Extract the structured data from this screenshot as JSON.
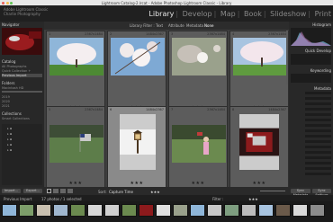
{
  "window": {
    "title": "Lightroom Catalog-2.lrcat - Adobe Photoshop Lightroom Classic - Library"
  },
  "identity": {
    "line1": "Adobe Lightroom Classic",
    "line2": "Charlie Photography"
  },
  "modules": {
    "items": [
      "Library",
      "Develop",
      "Map",
      "Book",
      "Slideshow",
      "Print"
    ],
    "active": "Library"
  },
  "left_panel": {
    "sections": [
      {
        "title": "Navigator",
        "items": []
      },
      {
        "title": "Catalog",
        "items": [
          "All Photographs",
          "Quick Collection +",
          "Previous Import"
        ]
      },
      {
        "title": "Folders",
        "items": [
          "Macintosh HD",
          "2019",
          "2020",
          "2021"
        ]
      },
      {
        "title": "Collections",
        "items": [
          "Smart Collections"
        ]
      }
    ],
    "import_label": "Import...",
    "export_label": "Export..."
  },
  "filter_bar": {
    "label": "Library Filter :",
    "options": [
      "Text",
      "Attribute",
      "Metadata",
      "None"
    ],
    "active": "None"
  },
  "grid": {
    "cells": [
      {
        "index": "1",
        "dims": "2367x1484",
        "rating": "★★★",
        "thumb": "cherry-blossom-tree",
        "selected": false
      },
      {
        "index": "2",
        "dims": "1484x2367",
        "rating": "★★★",
        "thumb": "white-blossoms-closeup",
        "selected": false
      },
      {
        "index": "3",
        "dims": "2367x1484",
        "rating": "★★★",
        "thumb": "single-blossom-bokeh",
        "selected": false
      },
      {
        "index": "4",
        "dims": "2367x1484",
        "rating": "★★★",
        "thumb": "blossom-tree-field",
        "selected": false
      },
      {
        "index": "5",
        "dims": "2367x1484",
        "rating": "★★★",
        "thumb": "us-flag-lawn",
        "selected": false
      },
      {
        "index": "6",
        "dims": "1484x2367",
        "rating": "★★★",
        "thumb": "lantern-post",
        "selected": true
      },
      {
        "index": "7",
        "dims": "2367x1484",
        "rating": "★★★",
        "thumb": "child-with-flag",
        "selected": false
      },
      {
        "index": "8",
        "dims": "1484x2367",
        "rating": "★★★",
        "thumb": "red-truck-grille",
        "selected": false
      }
    ]
  },
  "right_panel": {
    "sections": [
      {
        "title": "Histogram"
      },
      {
        "title": "Quick Develop"
      },
      {
        "title": "Keywording"
      },
      {
        "title": "Metadata"
      }
    ],
    "sync_metadata": "Sync Metadata",
    "sync_settings": "Sync Settings"
  },
  "toolbar": {
    "sort_label": "Sort:",
    "sort_value": "Capture Time"
  },
  "filmstrip": {
    "source": "Previous Import",
    "count": "17 photos / 1 selected",
    "filter_label": "Filter :"
  },
  "colors": {
    "accent": "#e6e6e6",
    "panel": "#282828",
    "grid_bg": "#3e3e3e"
  }
}
